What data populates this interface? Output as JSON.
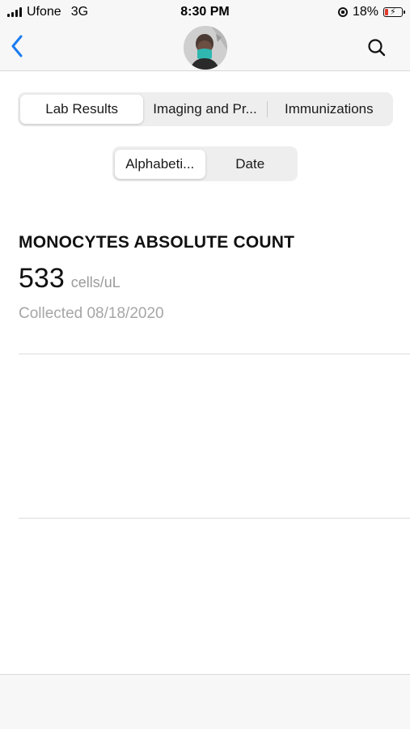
{
  "status_bar": {
    "carrier": "Ufone",
    "network": "3G",
    "time": "8:30 PM",
    "battery": "18%",
    "battery_level": 0.18,
    "battery_color": "#e23b2f",
    "icons": [
      "signal-bars-icon",
      "orientation-lock-icon",
      "battery-charging-icon"
    ]
  },
  "nav": {
    "back_icon": "chevron-left-icon",
    "search_icon": "search-icon",
    "accent_color": "#1a7cf0"
  },
  "category_tabs": [
    {
      "label": "Lab Results",
      "selected": true
    },
    {
      "label": "Imaging and Pr...",
      "selected": false
    },
    {
      "label": "Immunizations",
      "selected": false
    }
  ],
  "sort_tabs": [
    {
      "label": "Alphabeti...",
      "selected": true
    },
    {
      "label": "Date",
      "selected": false
    }
  ],
  "result": {
    "title": "MONOCYTES ABSOLUTE COUNT",
    "value": "533",
    "unit": "cells/uL",
    "collected": "Collected 08/18/2020"
  }
}
